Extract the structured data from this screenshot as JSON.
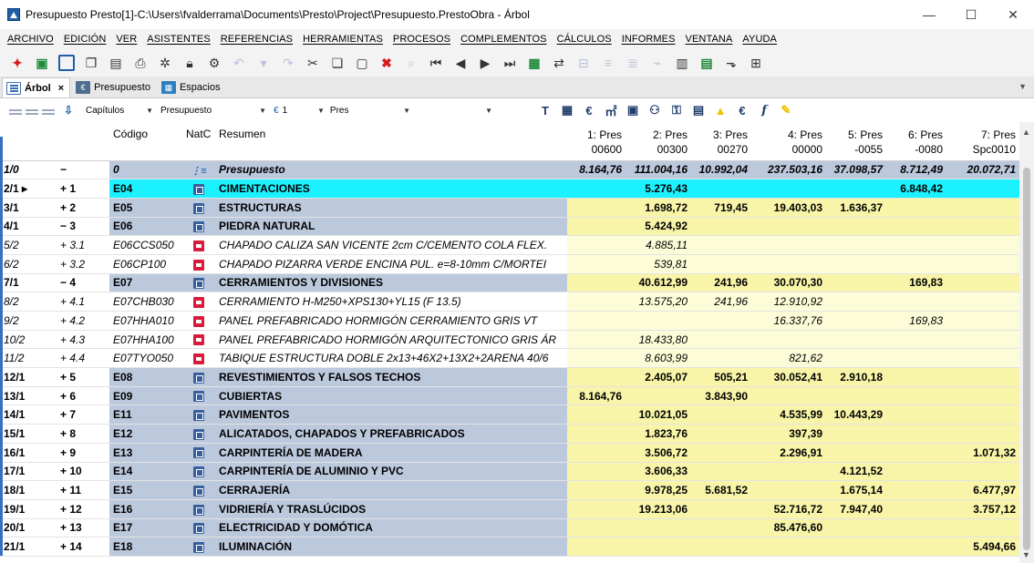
{
  "window": {
    "title": "Presupuesto Presto[1]-C:\\Users\\fvalderrama\\Documents\\Presto\\Project\\Presupuesto.PrestoObra - Árbol",
    "controls": {
      "minimize": "—",
      "maximize": "☐",
      "close": "✕"
    }
  },
  "menu": [
    "ARCHIVO",
    "EDICIÓN",
    "VER",
    "ASISTENTES",
    "REFERENCIAS",
    "HERRAMIENTAS",
    "PROCESOS",
    "COMPLEMENTOS",
    "CÁLCULOS",
    "INFORMES",
    "VENTANA",
    "AYUDA"
  ],
  "tabs": [
    {
      "label": "Árbol",
      "active": true,
      "close": "×",
      "icon": "tree-icon"
    },
    {
      "label": "Presupuesto",
      "active": false,
      "icon": "budget-icon"
    },
    {
      "label": "Espacios",
      "active": false,
      "icon": "spaces-icon"
    }
  ],
  "filter": {
    "combo1": "Capítulos",
    "combo2": "Presupuesto",
    "combo3": "1",
    "combo4": "Pres"
  },
  "grid": {
    "headers": {
      "row": "",
      "level": "",
      "code": "Código",
      "natc": "NatC",
      "summary": "Resumen",
      "pres": [
        {
          "l1": "1: Pres",
          "l2": "00600"
        },
        {
          "l1": "2: Pres",
          "l2": "00300"
        },
        {
          "l1": "3: Pres",
          "l2": "00270"
        },
        {
          "l1": "4: Pres",
          "l2": "00000"
        },
        {
          "l1": "5: Pres",
          "l2": "-0055"
        },
        {
          "l1": "6: Pres",
          "l2": "-0080"
        },
        {
          "l1": "7: Pres",
          "l2": "Spc0010"
        }
      ]
    },
    "rows": [
      {
        "row": "1/0",
        "level": "−",
        "code": "0",
        "type": "root",
        "summary": "Presupuesto",
        "v": [
          "8.164,76",
          "111.004,16",
          "10.992,04",
          "237.503,16",
          "37.098,57",
          "8.712,49",
          "20.072,71"
        ]
      },
      {
        "row": "2/1 ▸",
        "level": "+ 1",
        "code": "E04",
        "type": "chapter",
        "selected": true,
        "summary": "CIMENTACIONES",
        "v": [
          "",
          "5.276,43",
          "",
          "",
          "",
          "6.848,42",
          ""
        ]
      },
      {
        "row": "3/1",
        "level": "+ 2",
        "code": "E05",
        "type": "chapter",
        "summary": "ESTRUCTURAS",
        "v": [
          "",
          "1.698,72",
          "719,45",
          "19.403,03",
          "1.636,37",
          "",
          ""
        ]
      },
      {
        "row": "4/1",
        "level": "− 3",
        "code": "E06",
        "type": "chapter",
        "summary": "PIEDRA NATURAL",
        "v": [
          "",
          "5.424,92",
          "",
          "",
          "",
          "",
          ""
        ]
      },
      {
        "row": "5/2",
        "level": "+ 3.1",
        "code": "E06CCS050",
        "type": "item",
        "summary": "CHAPADO CALIZA SAN VICENTE 2cm C/CEMENTO COLA FLEX.",
        "v": [
          "",
          "4.885,11",
          "",
          "",
          "",
          "",
          ""
        ]
      },
      {
        "row": "6/2",
        "level": "+ 3.2",
        "code": "E06CP100",
        "type": "item",
        "summary": "CHAPADO PIZARRA VERDE ENCINA PUL. e=8-10mm C/MORTEI",
        "v": [
          "",
          "539,81",
          "",
          "",
          "",
          "",
          ""
        ]
      },
      {
        "row": "7/1",
        "level": "− 4",
        "code": "E07",
        "type": "chapter",
        "summary": "CERRAMIENTOS Y DIVISIONES",
        "v": [
          "",
          "40.612,99",
          "241,96",
          "30.070,30",
          "",
          "169,83",
          ""
        ]
      },
      {
        "row": "8/2",
        "level": "+ 4.1",
        "code": "E07CHB030",
        "type": "item",
        "summary": "CERRAMIENTO H-M250+XPS130+YL15 (F 13.5)",
        "v": [
          "",
          "13.575,20",
          "241,96",
          "12.910,92",
          "",
          "",
          ""
        ]
      },
      {
        "row": "9/2",
        "level": "+ 4.2",
        "code": "E07HHA010",
        "type": "item",
        "summary": "PANEL PREFABRICADO HORMIGÓN CERRAMIENTO GRIS VT",
        "v": [
          "",
          "",
          "",
          "16.337,76",
          "",
          "169,83",
          ""
        ]
      },
      {
        "row": "10/2",
        "level": "+ 4.3",
        "code": "E07HHA100",
        "type": "item",
        "summary": "PANEL PREFABRICADO HORMIGÓN ARQUITECTONICO GRIS ÁR",
        "v": [
          "",
          "18.433,80",
          "",
          "",
          "",
          "",
          ""
        ]
      },
      {
        "row": "11/2",
        "level": "+ 4.4",
        "code": "E07TYO050",
        "type": "item",
        "summary": "TABIQUE ESTRUCTURA DOBLE 2x13+46X2+13X2+2ARENA 40/6",
        "v": [
          "",
          "8.603,99",
          "",
          "821,62",
          "",
          "",
          ""
        ]
      },
      {
        "row": "12/1",
        "level": "+ 5",
        "code": "E08",
        "type": "chapter",
        "summary": "REVESTIMIENTOS Y FALSOS TECHOS",
        "v": [
          "",
          "2.405,07",
          "505,21",
          "30.052,41",
          "2.910,18",
          "",
          ""
        ]
      },
      {
        "row": "13/1",
        "level": "+ 6",
        "code": "E09",
        "type": "chapter",
        "summary": "CUBIERTAS",
        "v": [
          "8.164,76",
          "",
          "3.843,90",
          "",
          "",
          "",
          ""
        ]
      },
      {
        "row": "14/1",
        "level": "+ 7",
        "code": "E11",
        "type": "chapter",
        "summary": "PAVIMENTOS",
        "v": [
          "",
          "10.021,05",
          "",
          "4.535,99",
          "10.443,29",
          "",
          ""
        ]
      },
      {
        "row": "15/1",
        "level": "+ 8",
        "code": "E12",
        "type": "chapter",
        "summary": "ALICATADOS, CHAPADOS Y PREFABRICADOS",
        "v": [
          "",
          "1.823,76",
          "",
          "397,39",
          "",
          "",
          ""
        ]
      },
      {
        "row": "16/1",
        "level": "+ 9",
        "code": "E13",
        "type": "chapter",
        "summary": "CARPINTERÍA DE MADERA",
        "v": [
          "",
          "3.506,72",
          "",
          "2.296,91",
          "",
          "",
          "1.071,32"
        ]
      },
      {
        "row": "17/1",
        "level": "+ 10",
        "code": "E14",
        "type": "chapter",
        "summary": "CARPINTERÍA DE ALUMINIO Y PVC",
        "v": [
          "",
          "3.606,33",
          "",
          "",
          "4.121,52",
          "",
          ""
        ]
      },
      {
        "row": "18/1",
        "level": "+ 11",
        "code": "E15",
        "type": "chapter",
        "summary": "CERRAJERÍA",
        "v": [
          "",
          "9.978,25",
          "5.681,52",
          "",
          "1.675,14",
          "",
          "6.477,97"
        ]
      },
      {
        "row": "19/1",
        "level": "+ 12",
        "code": "E16",
        "type": "chapter",
        "summary": "VIDRIERÍA Y TRASLÚCIDOS",
        "v": [
          "",
          "19.213,06",
          "",
          "52.716,72",
          "7.947,40",
          "",
          "3.757,12"
        ]
      },
      {
        "row": "20/1",
        "level": "+ 13",
        "code": "E17",
        "type": "chapter",
        "summary": "ELECTRICIDAD Y DOMÓTICA",
        "v": [
          "",
          "",
          "",
          "85.476,60",
          "",
          "",
          ""
        ]
      },
      {
        "row": "21/1",
        "level": "+ 14",
        "code": "E18",
        "type": "chapter",
        "summary": "ILUMINACIÓN",
        "v": [
          "",
          "",
          "",
          "",
          "",
          "",
          "5.494,66"
        ]
      }
    ]
  },
  "colors": {
    "chapter_bg": "#bcc9dd",
    "selected_bg": "#1cf2ff",
    "value_bg": "#f8f5a9",
    "item_value_bg": "#fdfcd8",
    "chapter_badge": "#3a5f9e",
    "item_badge": "#d81b3a"
  }
}
